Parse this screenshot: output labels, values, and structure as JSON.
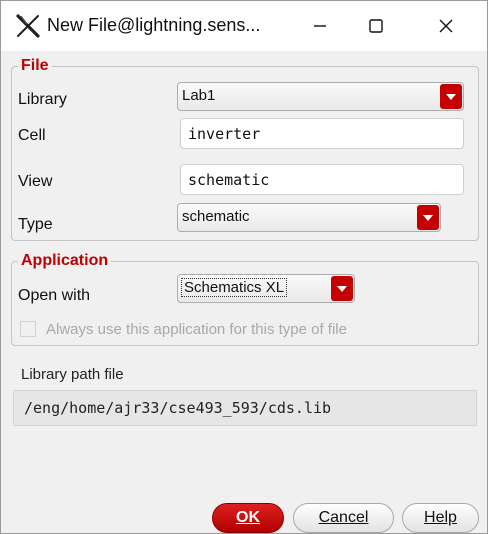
{
  "window": {
    "title": "New File@lightning.sens..."
  },
  "file_group": {
    "legend": "File",
    "library_label": "Library",
    "library_value": "Lab1",
    "cell_label": "Cell",
    "cell_value": "inverter",
    "view_label": "View",
    "view_value": "schematic",
    "type_label": "Type",
    "type_value": "schematic"
  },
  "application_group": {
    "legend": "Application",
    "open_with_label": "Open with",
    "open_with_value": "Schematics XL",
    "always_use_label": "Always use this application for this type of file",
    "always_use_checked": false
  },
  "library_path": {
    "label": "Library path file",
    "value": "/eng/home/ajr33/cse493_593/cds.lib"
  },
  "buttons": {
    "ok": "OK",
    "cancel": "Cancel",
    "help": "Help"
  },
  "colors": {
    "accent": "#c00000",
    "window_bg": "#f0f0f0"
  },
  "icons": [
    "app-x-icon",
    "minimize-icon",
    "maximize-icon",
    "close-icon",
    "chevron-down-icon"
  ]
}
